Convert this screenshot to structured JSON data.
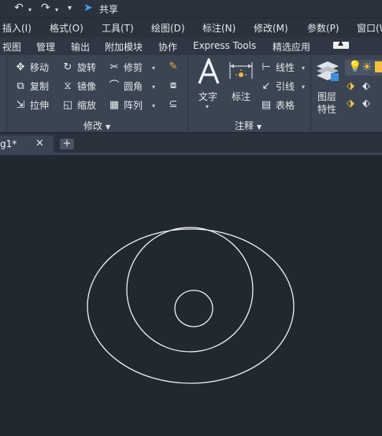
{
  "quick_access": {
    "share_label": "共享",
    "icons": [
      "undo-icon",
      "redo-icon",
      "customize-icon",
      "share-icon"
    ]
  },
  "menubar": {
    "items": [
      "插入(I)",
      "格式(O)",
      "工具(T)",
      "绘图(D)",
      "标注(N)",
      "修改(M)",
      "参数(P)",
      "窗口(W"
    ]
  },
  "tabs": {
    "items": [
      "视图",
      "管理",
      "输出",
      "附加模块",
      "协作",
      "Express Tools",
      "精选应用"
    ]
  },
  "ribbon": {
    "modify": {
      "title": "修改",
      "move": "移动",
      "rotate": "旋转",
      "trim": "修剪",
      "copy": "复制",
      "mirror": "镜像",
      "fillet": "圆角",
      "stretch": "拉伸",
      "scale": "缩放",
      "array": "阵列"
    },
    "annotation": {
      "title": "注释",
      "text": "文字",
      "dimension": "标注",
      "linear": "线性",
      "leader": "引线",
      "table": "表格"
    },
    "layers": {
      "properties_line1": "图层",
      "properties_line2": "特性"
    }
  },
  "document": {
    "tab_label": "g1*"
  },
  "colors": {
    "canvas_bg": "#212830",
    "ribbon_bg": "#3b4453",
    "menubar_bg": "#2b323d",
    "drawing_stroke": "#f2f2f2",
    "share_accent": "#3aa0ff"
  }
}
